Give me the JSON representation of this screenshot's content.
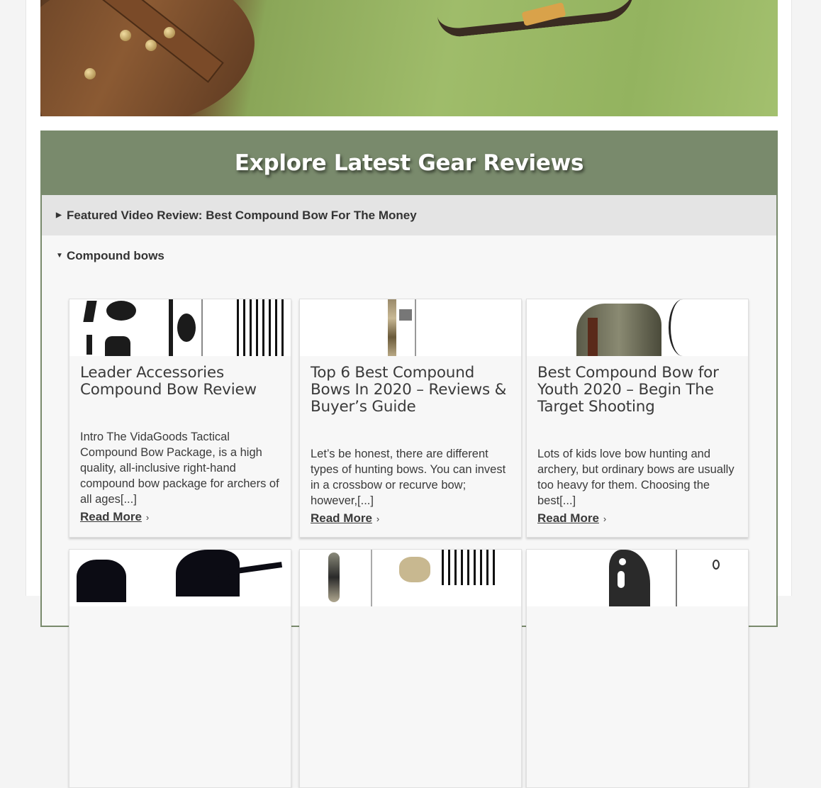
{
  "section": {
    "title": "Explore Latest Gear Reviews"
  },
  "accordion": [
    {
      "label": "Featured Video Review: Best Compound Bow For The Money",
      "state": "collapsed",
      "caret": "▶"
    },
    {
      "label": "Compound bows",
      "state": "expanded",
      "caret": "▼"
    }
  ],
  "cards": [
    {
      "title": "Leader Accessories Compound Bow Review",
      "excerpt": "Intro The VidaGoods Tactical Compound Bow Package, is a high quality, all-inclusive right-hand compound bow package for archers of all ages[...]",
      "link": "Read More",
      "thumb_icon": "bow-accessories-image"
    },
    {
      "title": "Top 6 Best Compound Bows In 2020 – Reviews & Buyer’s Guide",
      "excerpt": "Let’s be honest, there are different types of hunting bows. You can invest in a crossbow or recurve bow; however,[...]",
      "link": "Read More",
      "thumb_icon": "camo-bow-image"
    },
    {
      "title": "Best Compound Bow for Youth 2020 – Begin The Target Shooting",
      "excerpt": "Lots of kids love bow hunting and archery, but ordinary bows are usually too heavy for them. Choosing the best[...]",
      "link": "Read More",
      "thumb_icon": "archer-in-forest-image"
    }
  ],
  "row2_thumbs": [
    "archers-silhouette-image",
    "bow-package-image",
    "black-bow-riser-image"
  ],
  "chevron": "›",
  "colors": {
    "header": "#798a6c",
    "text": "#3a3a3a",
    "collapsed_row": "#e4e4e4"
  }
}
